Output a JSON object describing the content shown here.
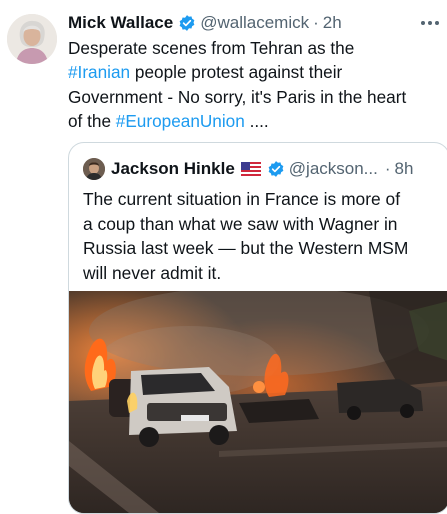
{
  "tweet": {
    "author_name": "Mick Wallace",
    "handle": "@wallacemick",
    "separator": "·",
    "time": "2h",
    "icons": {
      "verified": "verified-badge-icon",
      "more": "more-options-icon"
    },
    "text_lines": [
      [
        {
          "text": "Desperate scenes from Tehran as the",
          "type": "plain"
        }
      ],
      [
        {
          "text": "#Iranian",
          "type": "hashtag"
        },
        {
          "text": " people protest against their",
          "type": "plain"
        }
      ],
      [
        {
          "text": "Government - No sorry, it's Paris in the heart",
          "type": "plain"
        }
      ],
      [
        {
          "text": "of the ",
          "type": "plain"
        },
        {
          "text": "#EuropeanUnion",
          "type": "hashtag"
        },
        {
          "text": " ....",
          "type": "plain"
        }
      ]
    ]
  },
  "quote": {
    "author_name": "Jackson Hinkle",
    "handle": "@jackson...",
    "separator": "·",
    "time": "8h",
    "icons": {
      "flag": "us-flag-icon",
      "verified": "verified-badge-icon"
    },
    "text_lines": [
      "The current situation in France is more of",
      "a coup than what we saw with Wagner in",
      "Russia last week — but the Western MSM",
      "will never admit it."
    ]
  },
  "colors": {
    "text": "#0f1419",
    "muted": "#536471",
    "link": "#1d9bf0",
    "verified": "#1d9bf0",
    "border": "#cfd9de"
  }
}
